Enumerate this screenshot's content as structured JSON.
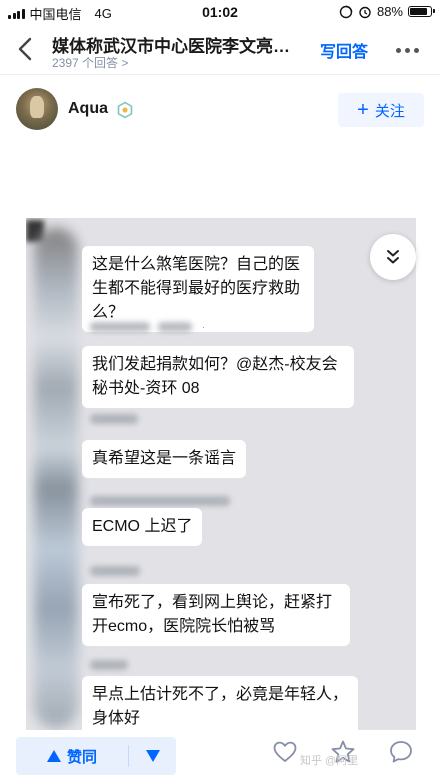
{
  "status_bar": {
    "carrier": "中国电信",
    "network": "4G",
    "time": "01:02",
    "battery": "88%",
    "battery_level": 0.88
  },
  "nav": {
    "title": "媒体称武汉市中心医院李文亮…",
    "answer_count": "2397 个回答 >",
    "write_answer": "写回答"
  },
  "author": {
    "name": "Aqua",
    "follow_label": "关注"
  },
  "chat": {
    "messages": [
      "这是什么煞笔医院？自己的医生都不能得到最好的医疗救助么？",
      "我们发起捐款如何？@赵杰-校友会秘书处-资环 08",
      "真希望这是一条谣言",
      "ECMO 上迟了",
      "宣布死了，看到网上舆论，赶紧打开ecmo，医院院长怕被骂",
      "早点上估计死不了，必竟是年轻人，身体好"
    ]
  },
  "bottom_bar": {
    "upvote_label": "赞同",
    "watermark": "知乎 @阿里"
  },
  "colors": {
    "accent": "#0066ff",
    "accent_bg": "#e8f0fe",
    "muted_text": "#8590a6"
  },
  "icons": [
    "back-arrow-icon",
    "more-dots-icon",
    "badge-icon",
    "plus-icon",
    "collapse-chevron-icon",
    "upvote-triangle-icon",
    "downvote-triangle-icon",
    "heart-icon",
    "star-icon",
    "comment-icon"
  ]
}
